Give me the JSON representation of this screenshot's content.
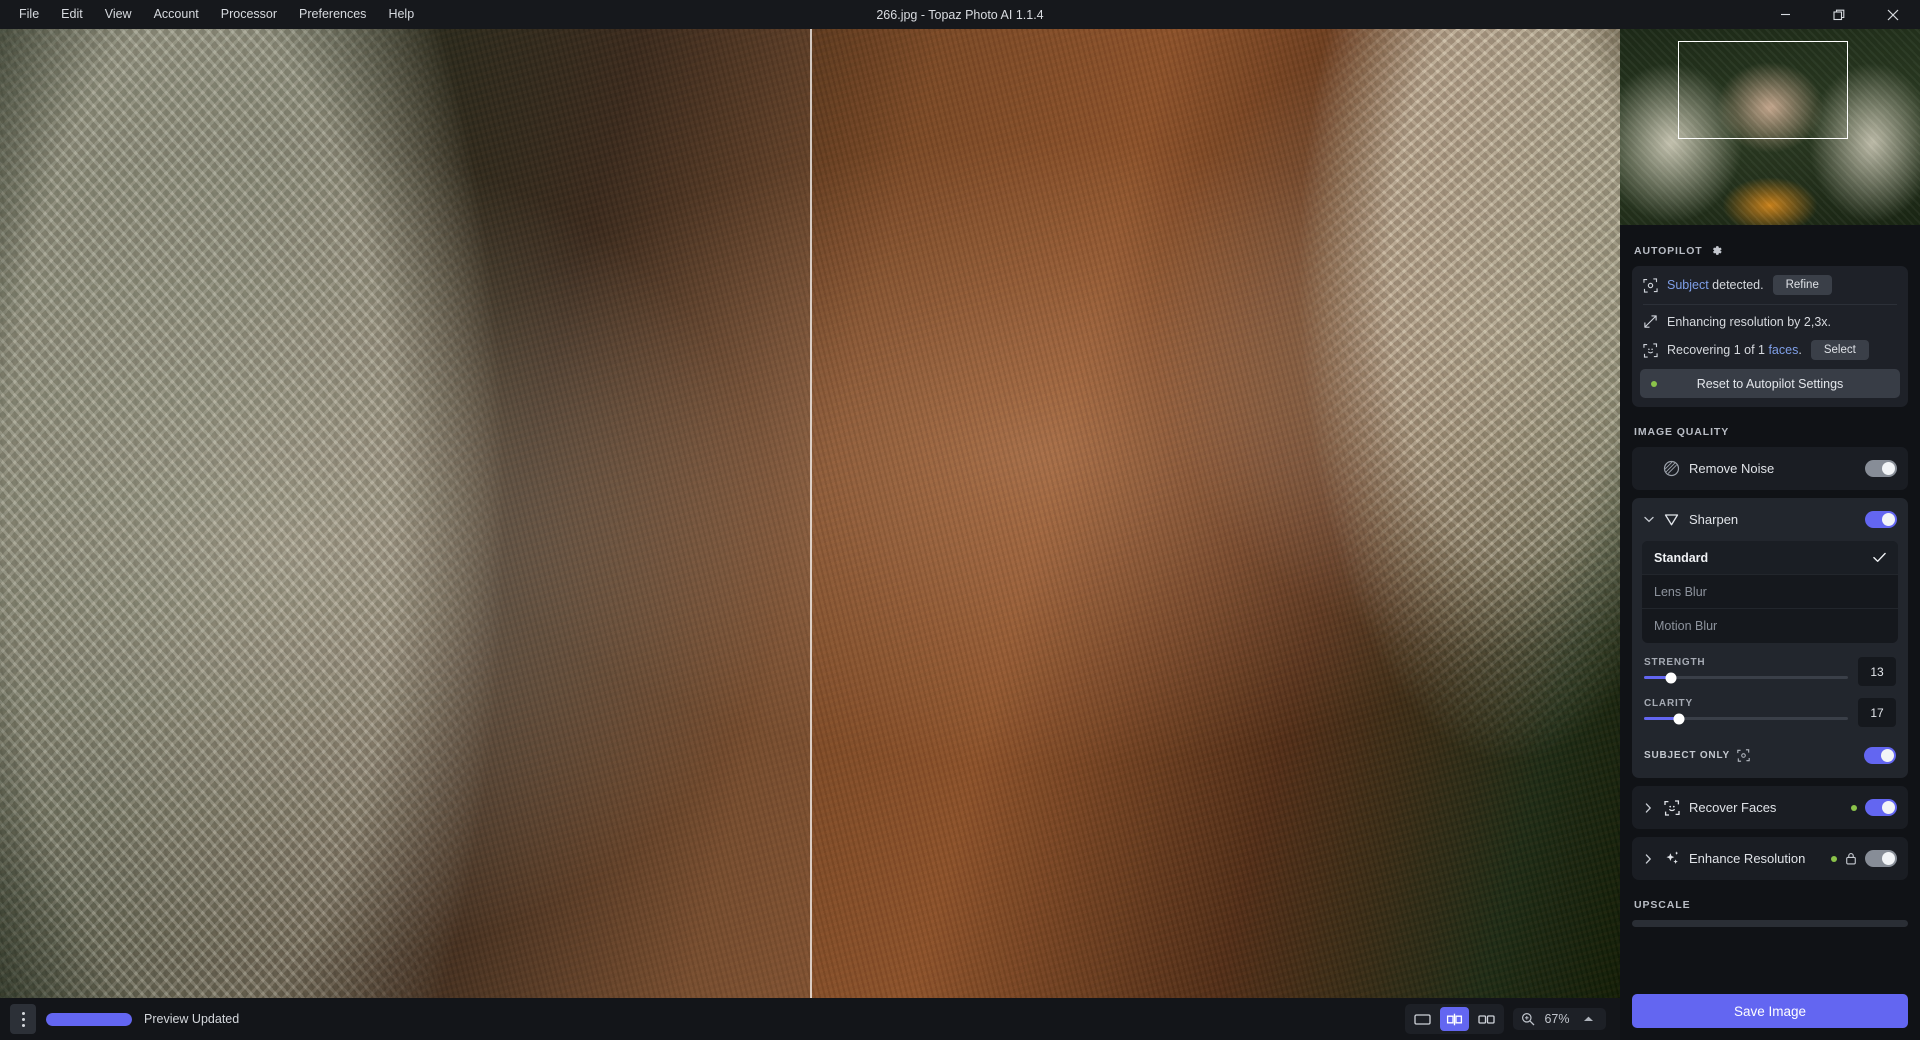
{
  "titlebar": {
    "title": "266.jpg - Topaz Photo AI 1.1.4",
    "menu": [
      "File",
      "Edit",
      "View",
      "Account",
      "Processor",
      "Preferences",
      "Help"
    ],
    "window_controls": [
      "minimize-icon",
      "maximize-icon",
      "close-icon"
    ]
  },
  "autopilot": {
    "heading": "AUTOPILOT",
    "gear_icon": "gear-icon",
    "subject_row": {
      "icon": "subject-frame-icon",
      "link_text": "Subject",
      "rest_text": " detected.",
      "button": "Refine"
    },
    "resolution_row": {
      "icon": "expand-arrows-icon",
      "text": "Enhancing resolution by 2,3x."
    },
    "faces_row": {
      "icon": "face-frame-icon",
      "prefix": "Recovering 1 of 1 ",
      "link_text": "faces",
      "suffix": ".",
      "button": "Select"
    },
    "reset_button": "Reset to Autopilot Settings",
    "reset_dot_color": "#8bc34a"
  },
  "image_quality": {
    "heading": "IMAGE QUALITY",
    "remove_noise": {
      "label": "Remove Noise",
      "icon": "noise-circle-icon",
      "enabled": false
    },
    "sharpen": {
      "label": "Sharpen",
      "icon": "sharpen-triangle-icon",
      "enabled": true,
      "expanded": true,
      "models": [
        {
          "label": "Standard",
          "selected": true
        },
        {
          "label": "Lens Blur",
          "selected": false
        },
        {
          "label": "Motion Blur",
          "selected": false
        }
      ],
      "sliders": [
        {
          "label": "STRENGTH",
          "value": "13",
          "percent": 13
        },
        {
          "label": "CLARITY",
          "value": "17",
          "percent": 17
        }
      ],
      "subject_only": {
        "label": "SUBJECT ONLY",
        "icon": "subject-frame-icon",
        "enabled": true
      }
    },
    "recover_faces": {
      "label": "Recover Faces",
      "icon": "face-smile-frame-icon",
      "enabled": true,
      "status_dot": "#8bc34a",
      "expanded": false
    },
    "enhance_resolution": {
      "label": "Enhance Resolution",
      "icon": "sparkles-icon",
      "enabled": false,
      "status_dot": "#8bc34a",
      "lock_icon": "lock-icon",
      "expanded": false
    }
  },
  "upscale": {
    "heading": "UPSCALE"
  },
  "footer": {
    "save_button": "Save Image",
    "accent": "#6366f1"
  },
  "statusbar": {
    "menu_icon": "kebab-menu-icon",
    "progress_percent": 100,
    "status": "Preview Updated",
    "view_modes": [
      {
        "name": "single-view",
        "icon": "single-pane-icon",
        "active": false
      },
      {
        "name": "split-view",
        "icon": "split-pane-icon",
        "active": true
      },
      {
        "name": "side-by-side-view",
        "icon": "side-by-side-icon",
        "active": false
      }
    ],
    "zoom_icon": "magnifier-icon",
    "zoom_level": "67%",
    "caret_icon": "caret-up-icon"
  },
  "navigator": {
    "viewport_rect": "navigator-viewport"
  }
}
